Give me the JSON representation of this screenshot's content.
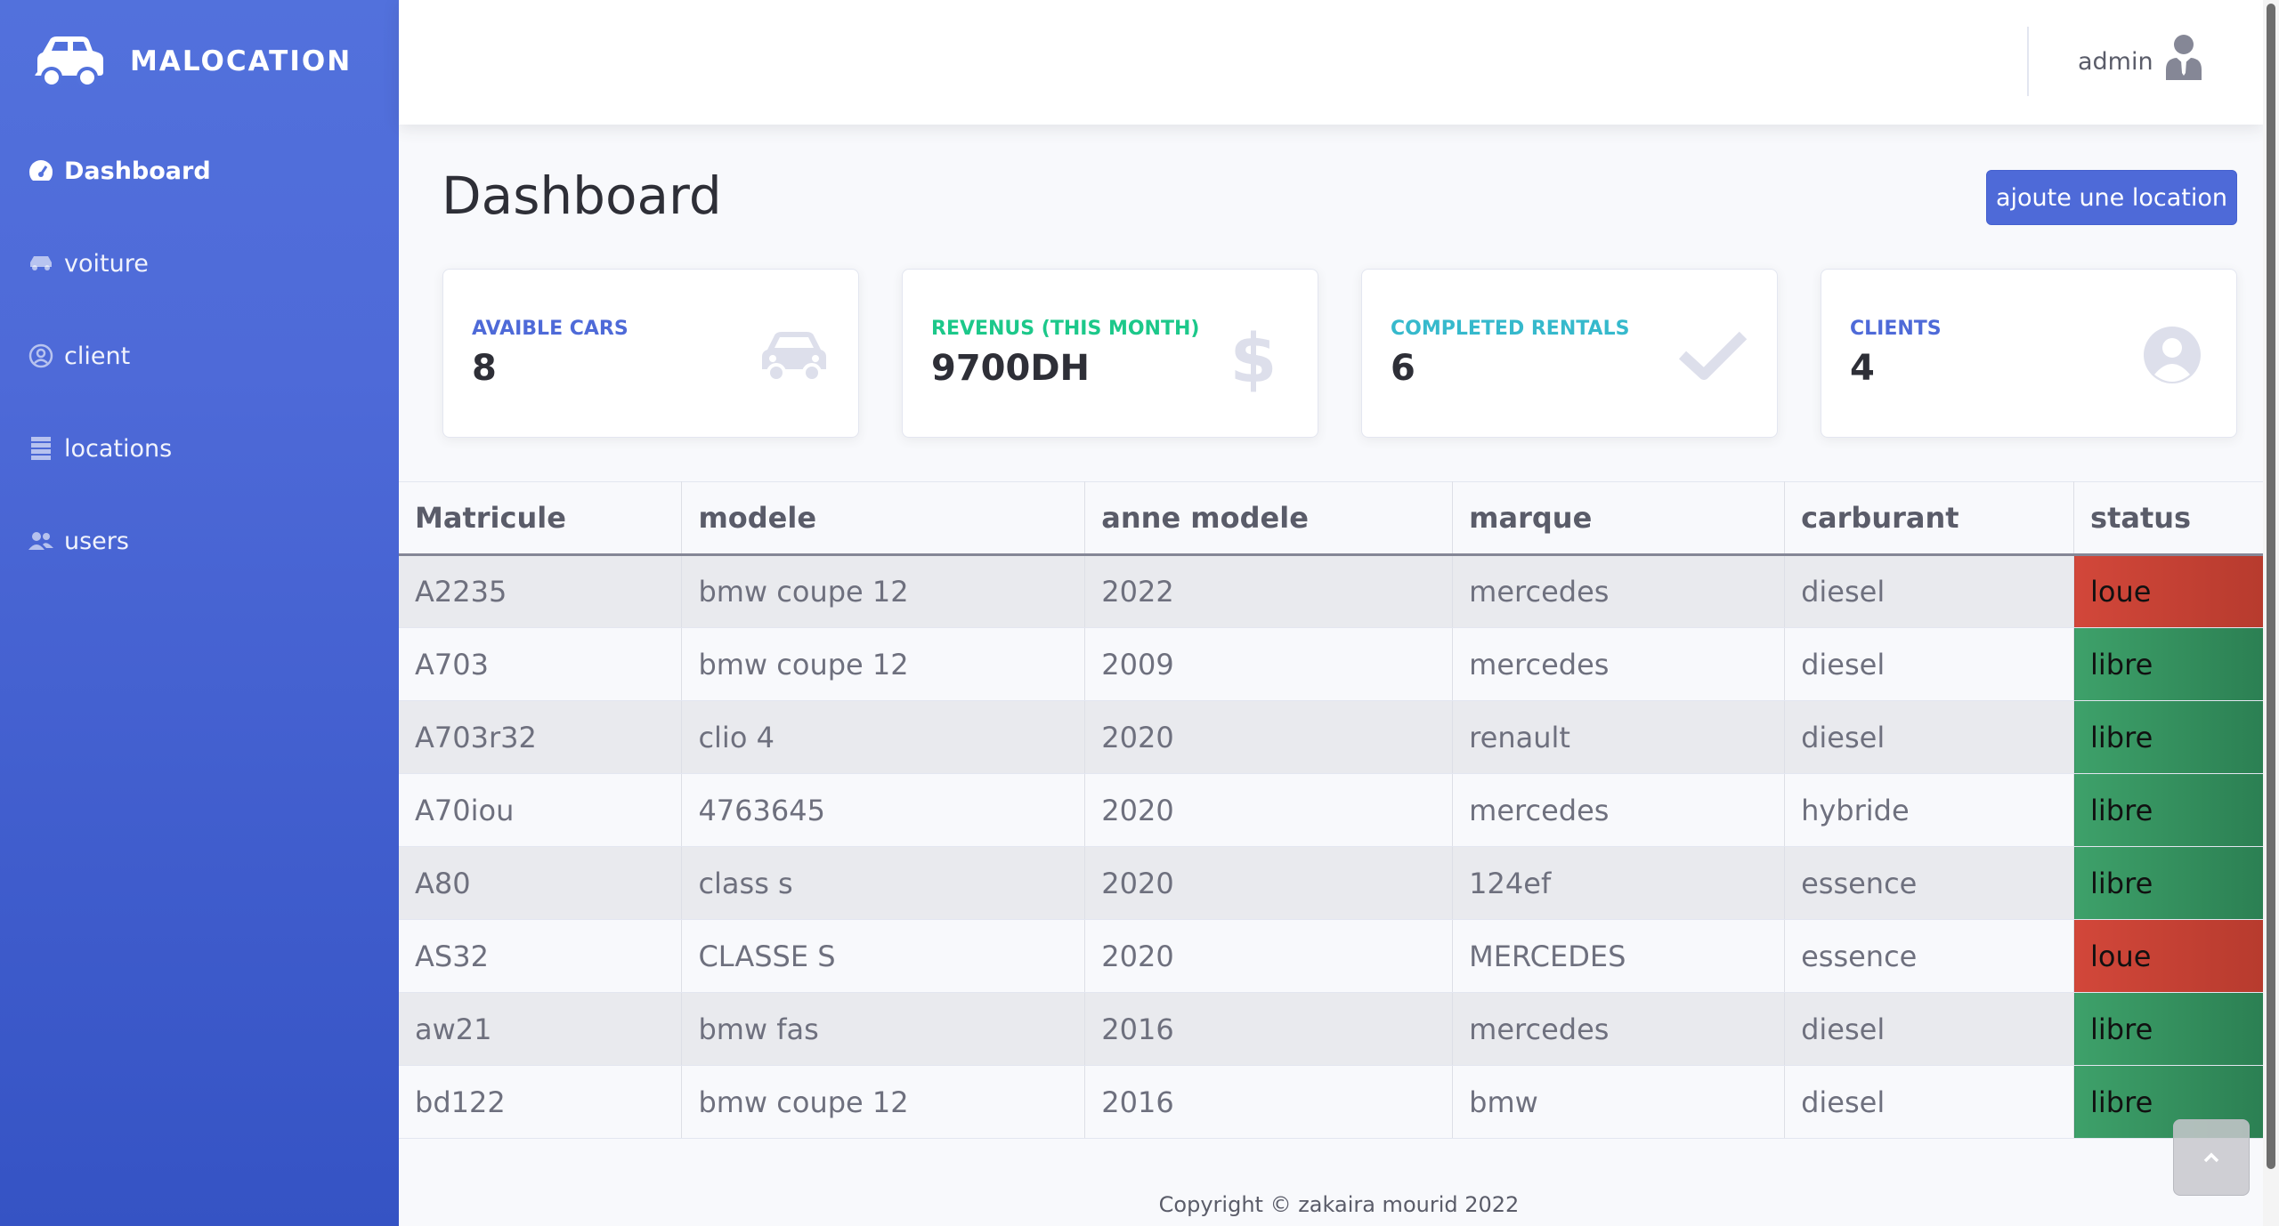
{
  "brand": {
    "name": "MALOCATION",
    "icon": "car-side-icon"
  },
  "sidebar": {
    "items": [
      {
        "label": "Dashboard",
        "icon": "gauge-icon",
        "active": true
      },
      {
        "label": "voiture",
        "icon": "car-icon",
        "active": false
      },
      {
        "label": "client",
        "icon": "user-circle-icon",
        "active": false
      },
      {
        "label": "locations",
        "icon": "list-icon",
        "active": false
      },
      {
        "label": "users",
        "icon": "users-icon",
        "active": false
      }
    ]
  },
  "topbar": {
    "username": "admin",
    "user_icon": "user-tie-icon"
  },
  "page": {
    "title": "Dashboard",
    "add_button": "ajoute une location"
  },
  "cards": [
    {
      "label": "AVAIBLE CARS",
      "value": "8",
      "icon": "car-icon",
      "color": "#4e6ad8"
    },
    {
      "label": "REVENUS (THIS MONTH)",
      "value": "9700DH",
      "icon": "dollar-icon",
      "color": "#1cc88a"
    },
    {
      "label": "COMPLETED RENTALS",
      "value": "6",
      "icon": "check-icon",
      "color": "#36b9cc"
    },
    {
      "label": "CLIENTS",
      "value": "4",
      "icon": "user-circle-icon",
      "color": "#4e6ad8"
    }
  ],
  "table": {
    "headers": [
      "Matricule",
      "modele",
      "anne modele",
      "marque",
      "carburant",
      "status"
    ],
    "rows": [
      [
        "A2235",
        "bmw coupe 12",
        "2022",
        "mercedes",
        "diesel",
        "loue"
      ],
      [
        "A703",
        "bmw coupe 12",
        "2009",
        "mercedes",
        "diesel",
        "libre"
      ],
      [
        "A703r32",
        "clio 4",
        "2020",
        "renault",
        "diesel",
        "libre"
      ],
      [
        "A70iou",
        "4763645",
        "2020",
        "mercedes",
        "hybride",
        "libre"
      ],
      [
        "A80",
        "class s",
        "2020",
        "124ef",
        "essence",
        "libre"
      ],
      [
        "AS32",
        "CLASSE S",
        "2020",
        "MERCEDES",
        "essence",
        "loue"
      ],
      [
        "aw21",
        "bmw fas",
        "2016",
        "mercedes",
        "diesel",
        "libre"
      ],
      [
        "bd122",
        "bmw coupe 12",
        "2016",
        "bmw",
        "diesel",
        "libre"
      ]
    ]
  },
  "footer": {
    "text": "Copyright © zakaira mourid 2022"
  },
  "scroll_top": {
    "icon": "chevron-up-icon"
  }
}
